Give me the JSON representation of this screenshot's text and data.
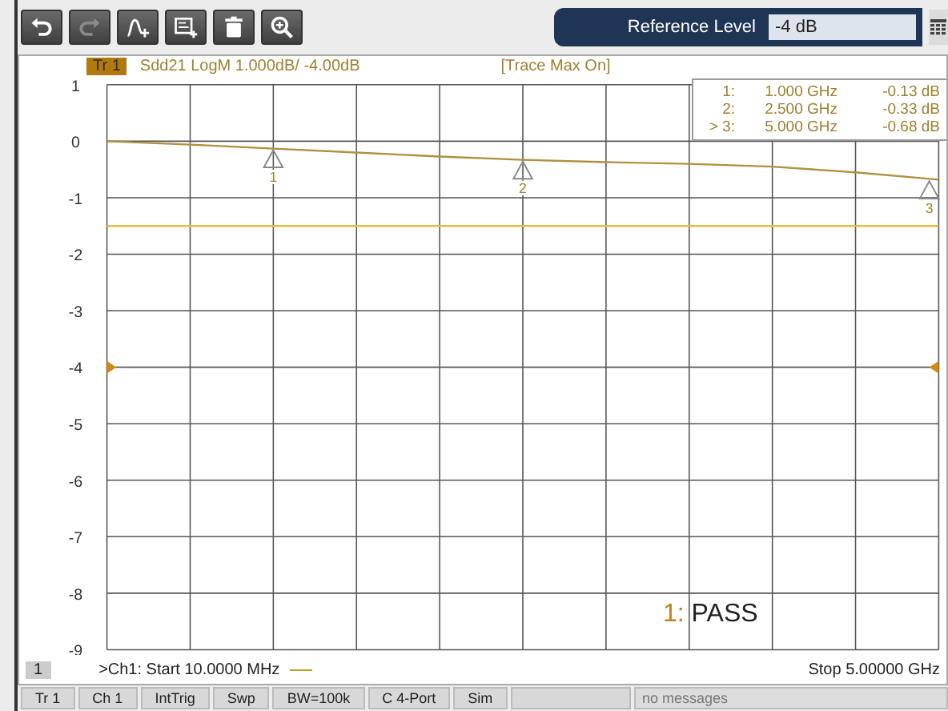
{
  "toolbar": {
    "buttons": [
      {
        "kind": "undo",
        "disabled": false
      },
      {
        "kind": "redo",
        "disabled": true
      },
      {
        "kind": "trace-add",
        "disabled": false
      },
      {
        "kind": "memory",
        "disabled": false
      },
      {
        "kind": "delete",
        "disabled": false
      },
      {
        "kind": "zoom",
        "disabled": false
      }
    ],
    "reference_level": {
      "label": "Reference Level",
      "value": "-4 dB"
    }
  },
  "trace_header": {
    "badge": "Tr 1",
    "description": "Sdd21 LogM 1.000dB/ -4.00dB",
    "status": "[Trace Max On]"
  },
  "marker_table": [
    {
      "label": "1:",
      "frequency": "1.000  GHz",
      "value": "-0.13 dB"
    },
    {
      "label": "2:",
      "frequency": "2.500  GHz",
      "value": "-0.33 dB"
    },
    {
      "label": "> 3:",
      "frequency": "5.000  GHz",
      "value": "-0.68 dB"
    }
  ],
  "chart_data": {
    "type": "line",
    "categories": [
      null,
      null,
      null,
      null,
      null,
      null,
      null,
      null,
      null,
      null,
      null
    ],
    "ylim": [
      -9,
      1
    ],
    "yticks": [
      1,
      0,
      -1,
      -2,
      -3,
      -4,
      -5,
      -6,
      -7,
      -8,
      -9
    ],
    "series": [
      {
        "color": "#b09040",
        "values": [
          0,
          -0.06,
          -0.13,
          -0.2,
          -0.27,
          -0.33,
          -0.37,
          -0.4,
          -0.45,
          -0.55,
          -0.68
        ]
      },
      {
        "color": "#e0c040",
        "values": [
          -1.5,
          -1.5,
          -1.5,
          -1.5,
          -1.5,
          -1.5,
          -1.5,
          -1.5,
          -1.5,
          -1.5,
          -1.5
        ]
      }
    ],
    "grid": true,
    "annotations": [
      {
        "text": "1",
        "y": -0.13
      },
      {
        "text": "2",
        "y": -0.33
      },
      {
        "text": "3",
        "y": -0.68
      }
    ]
  },
  "pass_indicator": {
    "prefix": "1:",
    "result": "PASS"
  },
  "footer": {
    "channel": "1",
    "start": ">Ch1:  Start  10.0000 MHz",
    "stop": "Stop 5.00000 GHz"
  },
  "status_bar": {
    "items": [
      "Tr 1",
      "Ch 1",
      "IntTrig",
      "Swp",
      "BW=100k",
      "C  4-Port",
      "Sim"
    ],
    "message": "no messages"
  }
}
